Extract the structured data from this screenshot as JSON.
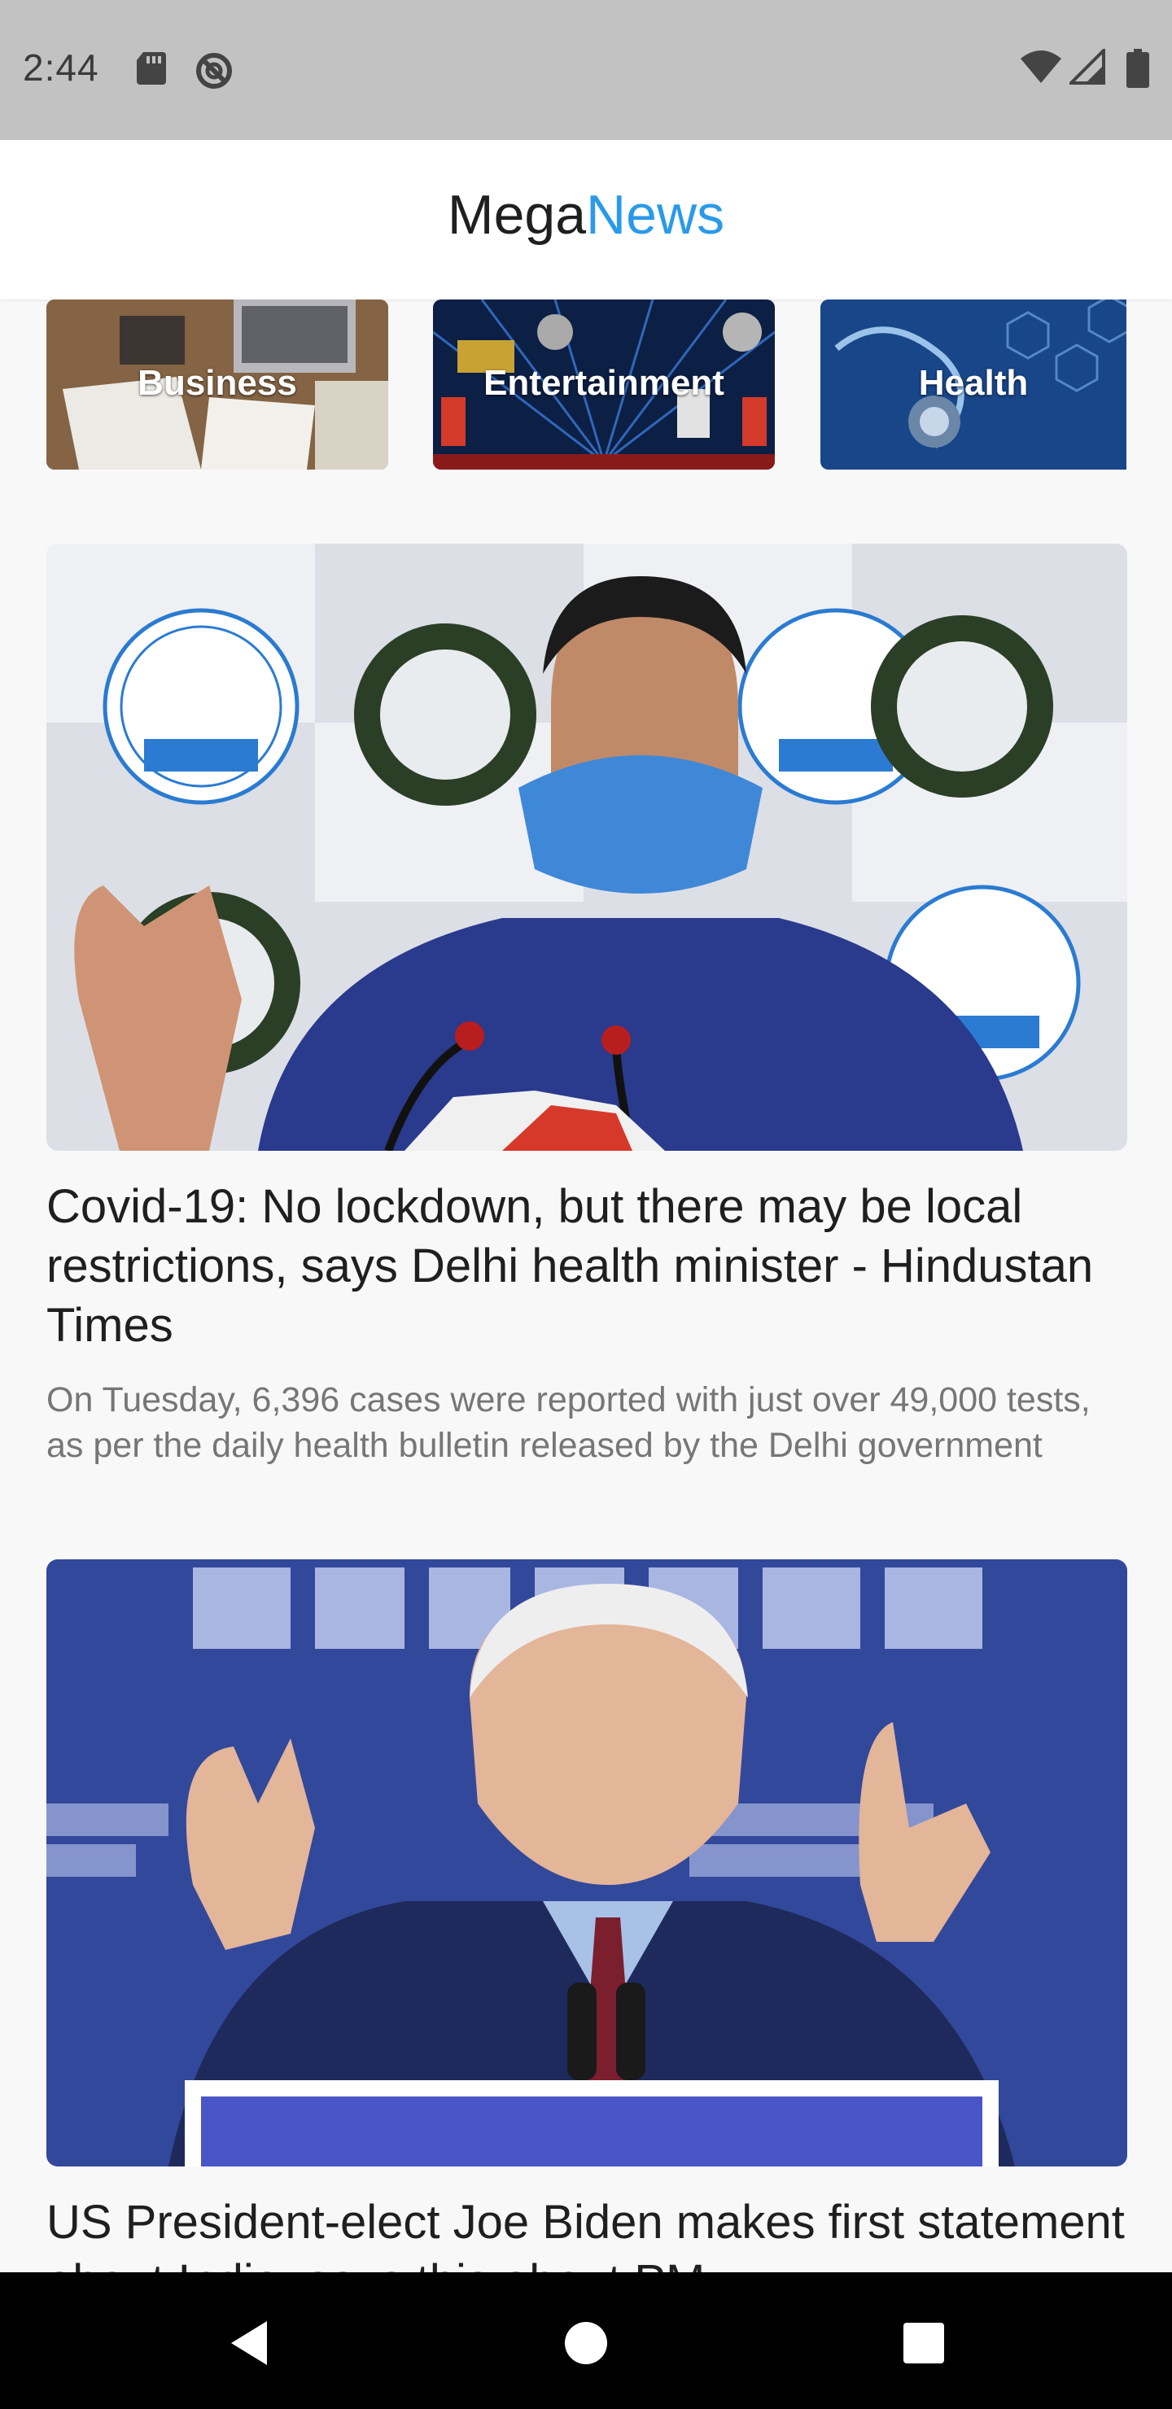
{
  "status_bar": {
    "time": "2:44",
    "left_icons": [
      "sd-card-icon",
      "do-not-disturb-icon"
    ],
    "right_icons": [
      "wifi-icon",
      "cell-signal-icon",
      "battery-icon"
    ]
  },
  "app": {
    "title_part1": "Mega",
    "title_part2": "News",
    "accent_color": "#2a9ae8"
  },
  "categories": [
    {
      "label": "Business"
    },
    {
      "label": "Entertainment"
    },
    {
      "label": "Health"
    }
  ],
  "articles": [
    {
      "title": "Covid-19: No lockdown, but there may be local restrictions, says Delhi health minister - Hindustan Times",
      "description": "On Tuesday, 6,396 cases were reported with just over 49,000 tests, as per the daily health bulletin released by the Delhi government",
      "image": "aap-press-conference-photo"
    },
    {
      "title": "US President-elect Joe Biden makes first statement about India, says this about PM",
      "image": "biden-speech-photo"
    }
  ],
  "nav_bar": {
    "buttons": [
      "back-icon",
      "home-icon",
      "recents-icon"
    ]
  }
}
